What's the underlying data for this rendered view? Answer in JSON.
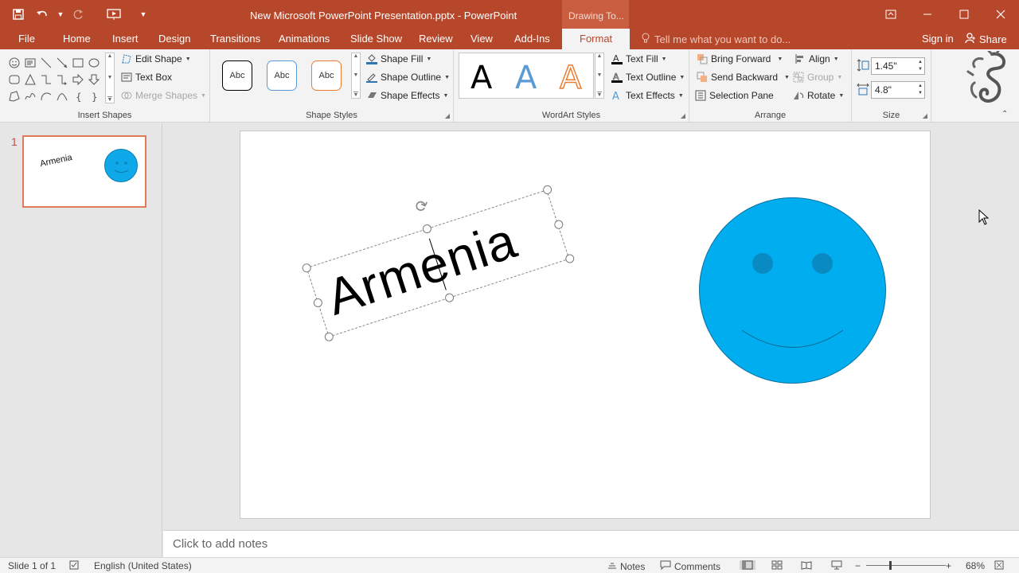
{
  "title_bar": {
    "document_title": "New Microsoft PowerPoint Presentation.pptx - PowerPoint",
    "contextual_tab_group": "Drawing To...",
    "qat_icons": [
      "save-icon",
      "undo-icon",
      "redo-icon",
      "start-from-beginning-icon",
      "customize-qat-icon"
    ],
    "window_controls": [
      "ribbon-display-options-icon",
      "minimize-icon",
      "maximize-icon",
      "close-icon"
    ]
  },
  "tabs": {
    "file": "File",
    "home": "Home",
    "insert": "Insert",
    "design": "Design",
    "transitions": "Transitions",
    "animations": "Animations",
    "slide_show": "Slide Show",
    "review": "Review",
    "view": "View",
    "add_ins": "Add-Ins",
    "format": "Format",
    "active": "Format"
  },
  "tell_me": "Tell me what you want to do...",
  "sign_in": "Sign in",
  "share": "Share",
  "ribbon": {
    "insert_shapes": {
      "label": "Insert Shapes",
      "edit_shape": "Edit Shape",
      "text_box": "Text Box",
      "merge_shapes": "Merge Shapes"
    },
    "shape_styles": {
      "label": "Shape Styles",
      "swatches": [
        {
          "text": "Abc",
          "border": "#000000"
        },
        {
          "text": "Abc",
          "border": "#5b9bd5"
        },
        {
          "text": "Abc",
          "border": "#ed7d31"
        }
      ],
      "shape_fill": "Shape Fill",
      "shape_outline": "Shape Outline",
      "shape_effects": "Shape Effects"
    },
    "wordart_styles": {
      "label": "WordArt Styles",
      "letters": [
        {
          "text": "A",
          "color": "#000000"
        },
        {
          "text": "A",
          "color": "#5b9bd5"
        },
        {
          "text": "A",
          "color": "#ed7d31"
        }
      ],
      "text_fill": "Text Fill",
      "text_outline": "Text Outline",
      "text_effects": "Text Effects"
    },
    "arrange": {
      "label": "Arrange",
      "bring_forward": "Bring Forward",
      "send_backward": "Send Backward",
      "selection_pane": "Selection Pane",
      "align": "Align",
      "group": "Group",
      "rotate": "Rotate"
    },
    "size": {
      "label": "Size",
      "height": "1.45\"",
      "width": "4.8\""
    }
  },
  "thumbnail": {
    "number": "1",
    "text": "Armenia"
  },
  "slide": {
    "textbox_text": "Armenia",
    "smiley_color": "#00aeef"
  },
  "notes": {
    "placeholder": "Click to add notes"
  },
  "status_bar": {
    "slide_count": "Slide 1 of 1",
    "language": "English (United States)",
    "notes": "Notes",
    "comments": "Comments",
    "zoom": "68%"
  },
  "colors": {
    "accent": "#b7472a",
    "selection": "#e07a5a"
  }
}
